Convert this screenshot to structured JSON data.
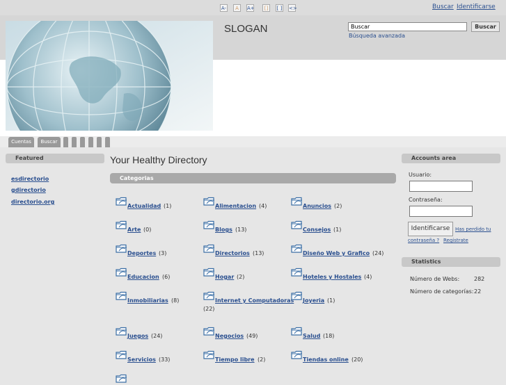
{
  "topbar": {
    "tools": [
      "A-",
      "A",
      "A+",
      "[]",
      "[ ]",
      "<>"
    ],
    "search_link": "Buscar",
    "login_link": "Identificarse"
  },
  "header": {
    "slogan": "SLOGAN",
    "search_value": "Buscar",
    "search_button": "Buscar",
    "advanced_search": "Búsqueda avanzada"
  },
  "nav": {
    "tabs": [
      "Cuentas",
      "Buscar"
    ]
  },
  "left": {
    "heading": "Featured",
    "links": [
      "esdirectorio",
      "gdirectorio",
      "directorio.org"
    ]
  },
  "main": {
    "title": "Your Healthy Directory",
    "section": "Categorias",
    "categories": [
      {
        "name": "Actualidad",
        "count": "(1)"
      },
      {
        "name": "Alimentacion",
        "count": "(4)"
      },
      {
        "name": "Anuncios",
        "count": "(2)"
      },
      {
        "name": "Arte",
        "count": "(0)"
      },
      {
        "name": "Blogs",
        "count": "(13)"
      },
      {
        "name": "Consejos",
        "count": "(1)"
      },
      {
        "name": "Deportes",
        "count": "(3)"
      },
      {
        "name": "Directorios",
        "count": "(13)"
      },
      {
        "name": "Diseño Web y Grafico",
        "count": "(24)"
      },
      {
        "name": "Educacion",
        "count": "(6)"
      },
      {
        "name": "Hogar",
        "count": "(2)"
      },
      {
        "name": "Hoteles y Hostales",
        "count": "(4)"
      },
      {
        "name": "Inmobiliarias",
        "count": "(8)"
      },
      {
        "name": "Internet y Computadoras",
        "count": "(22)"
      },
      {
        "name": "Joyeria",
        "count": "(1)"
      },
      {
        "name": "Juegos",
        "count": "(24)"
      },
      {
        "name": "Negocios",
        "count": "(49)"
      },
      {
        "name": "Salud",
        "count": "(18)"
      },
      {
        "name": "Servicios",
        "count": "(33)"
      },
      {
        "name": "Tiempo libre",
        "count": "(2)"
      },
      {
        "name": "Tiendas online",
        "count": "(20)"
      }
    ]
  },
  "accounts": {
    "heading": "Accounts area",
    "user_label": "Usuario:",
    "password_label": "Contraseña:",
    "login_button": "Identificarse",
    "forgot_1": "Has perdido tu",
    "forgot_2": "contraseña ?",
    "register": "Registrate"
  },
  "stats": {
    "heading": "Statistics",
    "rows": [
      {
        "label": "Número de Webs:",
        "value": "282"
      },
      {
        "label": "Número de categorías:",
        "value": "22"
      }
    ]
  }
}
